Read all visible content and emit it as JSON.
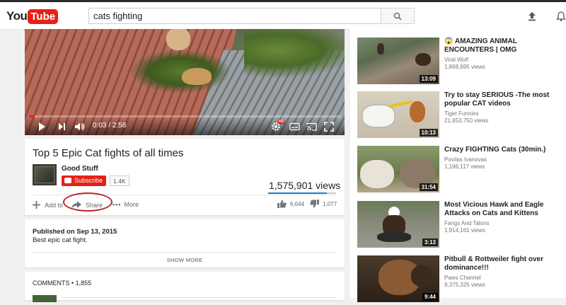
{
  "header": {
    "logo_you": "You",
    "logo_tube": "Tube",
    "search_value": "cats fighting"
  },
  "player": {
    "time": "0:03 / 2:58",
    "progress": 0.017,
    "hd_badge": "HD"
  },
  "video": {
    "title": "Top 5 Epic Cat fights of all times",
    "channel": "Good Stuff",
    "subscribe_label": "Subscribe",
    "subscriber_count": "1.4K",
    "views": "1,575,901 views",
    "like_ratio": 0.86,
    "add_to_label": "Add to",
    "share_label": "Share",
    "more_label": "More",
    "likes": "6,644",
    "dislikes": "1,077"
  },
  "description": {
    "published": "Published on Sep 13, 2015",
    "text": "Best epic cat fight.",
    "show_more": "SHOW MORE"
  },
  "comments": {
    "label": "COMMENTS • 1,855"
  },
  "recommendations": [
    {
      "title_prefix": "😱",
      "title": "AMAZING ANIMAL ENCOUNTERS | OMG",
      "channel": "Viral Wolf",
      "views": "1,868,695 views",
      "duration": "13:09"
    },
    {
      "title_prefix": "",
      "title": "Try to stay SERIOUS -The most popular CAT videos",
      "channel": "Tiger Funnies",
      "views": "21,653,750 views",
      "duration": "10:13"
    },
    {
      "title_prefix": "",
      "title": "Crazy FIGHTING Cats (30min.)",
      "channel": "Povilas Ivanovas",
      "views": "1,196,117 views",
      "duration": "31:54"
    },
    {
      "title_prefix": "",
      "title": "Most Vicious Hawk and Eagle Attacks on Cats and Kittens",
      "channel": "Fangs And Talons",
      "views": "1,914,161 views",
      "duration": "3:13"
    },
    {
      "title_prefix": "",
      "title": "Pitbull & Rottweiler fight over dominance!!!",
      "channel": "Paws Channel",
      "views": "9,375,325 views",
      "duration": "9:44"
    }
  ],
  "colors": {
    "brand_red": "#e62117",
    "link_blue": "#167ac6",
    "annotation_circle": "#b9262a"
  }
}
